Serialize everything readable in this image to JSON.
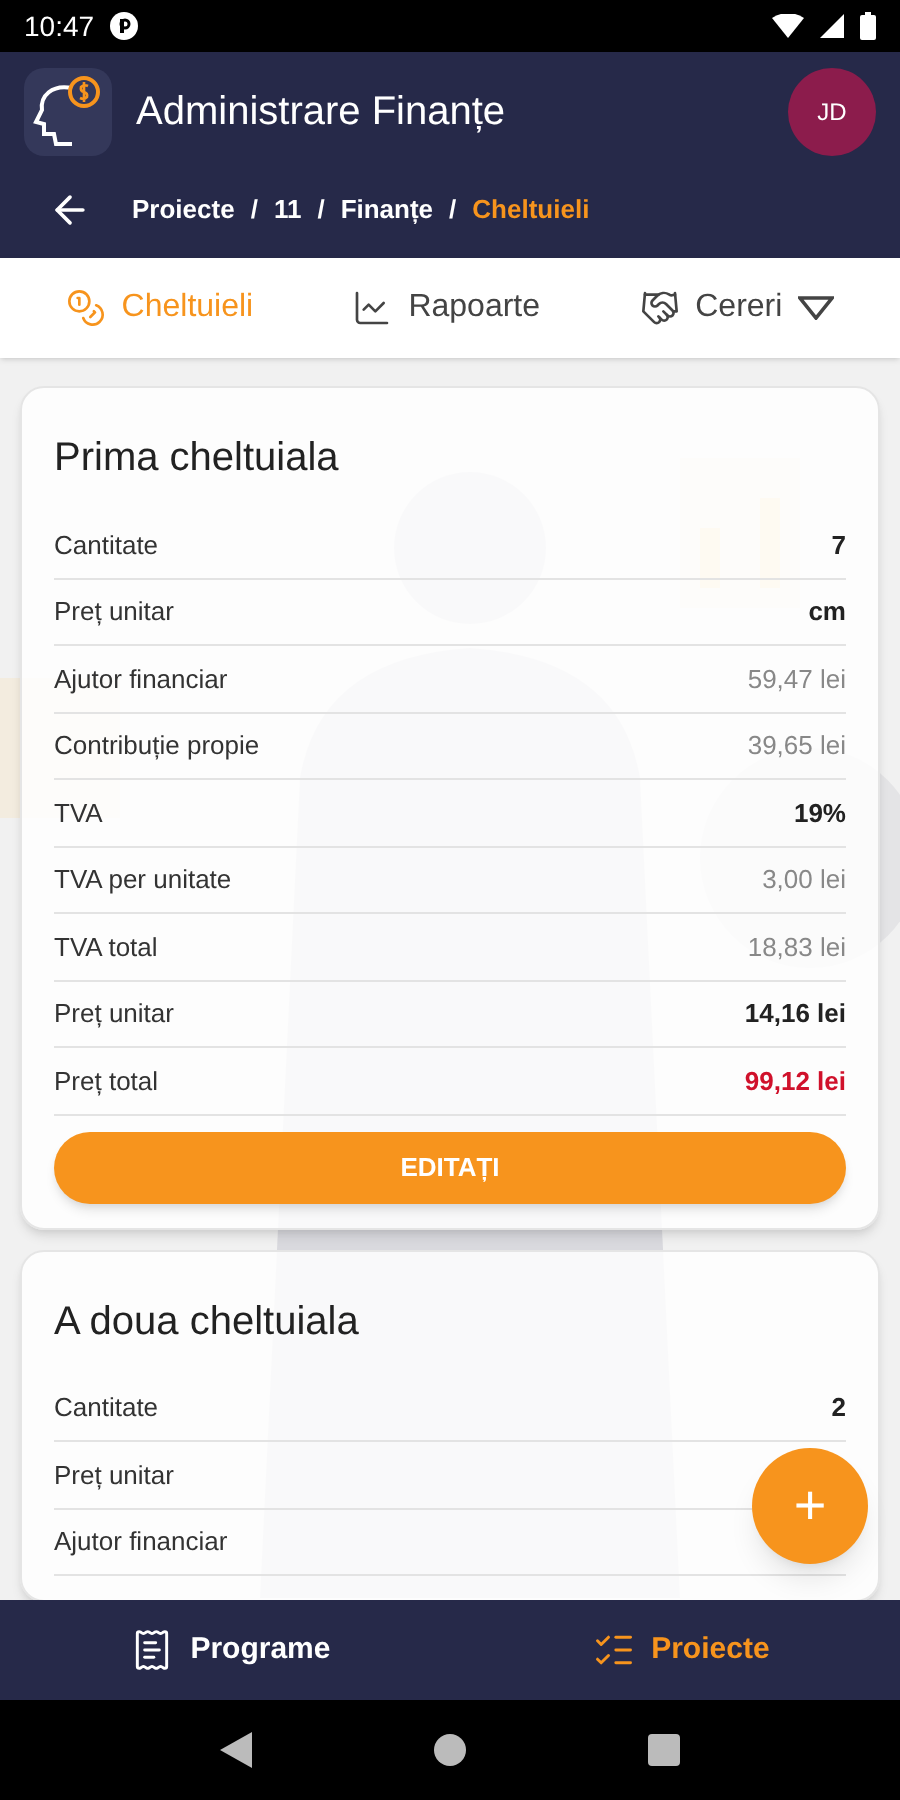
{
  "status_bar": {
    "time": "10:47"
  },
  "header": {
    "title": "Administrare Finanțe",
    "avatar": "JD"
  },
  "breadcrumb": [
    {
      "label": "Proiecte",
      "selected": false
    },
    {
      "label": "11",
      "selected": false
    },
    {
      "label": "Finanțe",
      "selected": false
    },
    {
      "label": "Cheltuieli",
      "selected": true
    }
  ],
  "breadcrumb_separator": "/",
  "tabs": [
    {
      "label": "Cheltuieli",
      "kind": "coins",
      "selected": true,
      "dropdown": false
    },
    {
      "label": "Rapoarte",
      "kind": "chart",
      "selected": false,
      "dropdown": false
    },
    {
      "label": "Cereri",
      "kind": "handshake",
      "selected": false,
      "dropdown": true
    }
  ],
  "cards": [
    {
      "title": "Prima cheltuiala",
      "button": "EDITAȚI",
      "rows": [
        {
          "label": "Cantitate",
          "value": "7",
          "kind": "strong"
        },
        {
          "label": "Preț unitar",
          "value": "cm",
          "kind": "strong"
        },
        {
          "label": "Ajutor financiar",
          "value": "59,47 lei",
          "kind": "muted"
        },
        {
          "label": "Contribuție propie",
          "value": "39,65 lei",
          "kind": "muted"
        },
        {
          "label": "TVA",
          "value": "19%",
          "kind": "strong"
        },
        {
          "label": "TVA per unitate",
          "value": "3,00 lei",
          "kind": "muted"
        },
        {
          "label": "TVA total",
          "value": "18,83 lei",
          "kind": "muted"
        },
        {
          "label": "Preț unitar",
          "value": "14,16 lei",
          "kind": "strong"
        },
        {
          "label": "Preț total",
          "value": "99,12 lei",
          "kind": "total"
        }
      ]
    },
    {
      "title": "A doua cheltuiala",
      "rows": [
        {
          "label": "Cantitate",
          "value": "2",
          "kind": "strong"
        },
        {
          "label": "Preț unitar"
        },
        {
          "label": "Ajutor financiar"
        }
      ]
    }
  ],
  "fab": "+",
  "bottom_nav": [
    {
      "label": "Programe",
      "kind": "document",
      "selected": false
    },
    {
      "label": "Proiecte",
      "kind": "checklist",
      "selected": true
    }
  ]
}
